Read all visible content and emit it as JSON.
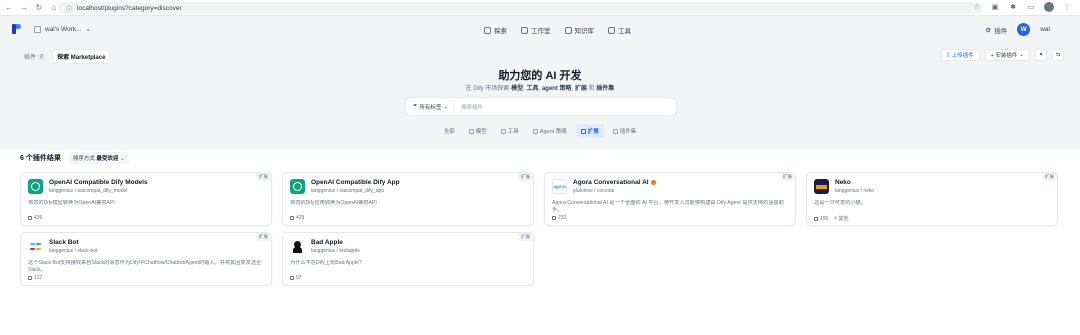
{
  "browser": {
    "url": "localhost/plugins?category=discover",
    "back": "←",
    "forward": "→",
    "reload": "↻",
    "home": "⌂"
  },
  "header": {
    "workspace": "wal's Work...",
    "nav": [
      {
        "label": "探索",
        "icon": "compass-icon"
      },
      {
        "label": "工作室",
        "icon": "studio-icon"
      },
      {
        "label": "知识库",
        "icon": "knowledge-icon"
      },
      {
        "label": "工具",
        "icon": "tool-icon"
      }
    ],
    "plugin_label": "插件",
    "avatar_letter": "W",
    "user_name": "wal"
  },
  "hero": {
    "tab_plugins": "插件",
    "tab_plugins_count": "2",
    "tab_marketplace": "探索 Marketplace",
    "title": "助力您的 AI 开发",
    "subtitle_prefix": "在 Dify 市场探索",
    "subtitle_models": "模型",
    "subtitle_tools": "工具",
    "subtitle_agent": "agent 策略",
    "subtitle_ext": "扩展",
    "subtitle_and": "和",
    "subtitle_bundles": "插件集",
    "submit_plugin": "上传插件",
    "install_plugin": "+ 安装插件",
    "tag_filter": "所有标签",
    "search_placeholder": "搜索插件",
    "categories": [
      {
        "label": "全部",
        "active": false
      },
      {
        "label": "模型",
        "active": false
      },
      {
        "label": "工具",
        "active": false
      },
      {
        "label": "Agent 策略",
        "active": false
      },
      {
        "label": "扩展",
        "active": true
      },
      {
        "label": "插件集",
        "active": false
      }
    ]
  },
  "results": {
    "count_label": "6 个插件结果",
    "sort_prefix": "排序方式",
    "sort_value": "最受欢迎",
    "cards": [
      {
        "name": "OpenAI Compatible Dify Models",
        "org": "langgenius / oaicompat_dify_model",
        "desc": "将您的Dify模型转换为OpenAI兼容API",
        "downloads": "439",
        "badge": "扩展",
        "icon": "openai-icon"
      },
      {
        "name": "OpenAI Compatible Dify App",
        "org": "langgenius / oaicompat_dify_app",
        "desc": "将您的Dify应用转换为OpenAI兼容API",
        "downloads": "429",
        "badge": "扩展",
        "icon": "openai-icon"
      },
      {
        "name": "Agora Conversational AI",
        "org": "plutoless / convoai",
        "desc": "Agora Conversational AI 是一个全面的 AI 平台，使开发人员能够构建由 Dify Agent 提供支持的语音助手。",
        "downloads": "232",
        "badge": "扩展",
        "icon": "agora-icon"
      },
      {
        "name": "Neko",
        "org": "langgenius / neko",
        "desc": "这是一只可爱的小猫。",
        "downloads": "195",
        "tag": "# 其他",
        "badge": "扩展",
        "icon": "neko-icon"
      },
      {
        "name": "Slack Bot",
        "org": "langgenius / slack-bot",
        "desc": "这个Slack Bot支持接收来自Slack的消息作为Dify中Chatflow/Chatbot/Agent的输入，并将其回复发送至Slack。",
        "downloads": "137",
        "badge": "扩展",
        "icon": "slack-icon"
      },
      {
        "name": "Bad Apple",
        "org": "langgenius / badapple",
        "desc": "为什么不在Dify上玩Bad Apple?",
        "downloads": "97",
        "badge": "扩展",
        "icon": "bad-apple-icon"
      }
    ]
  }
}
